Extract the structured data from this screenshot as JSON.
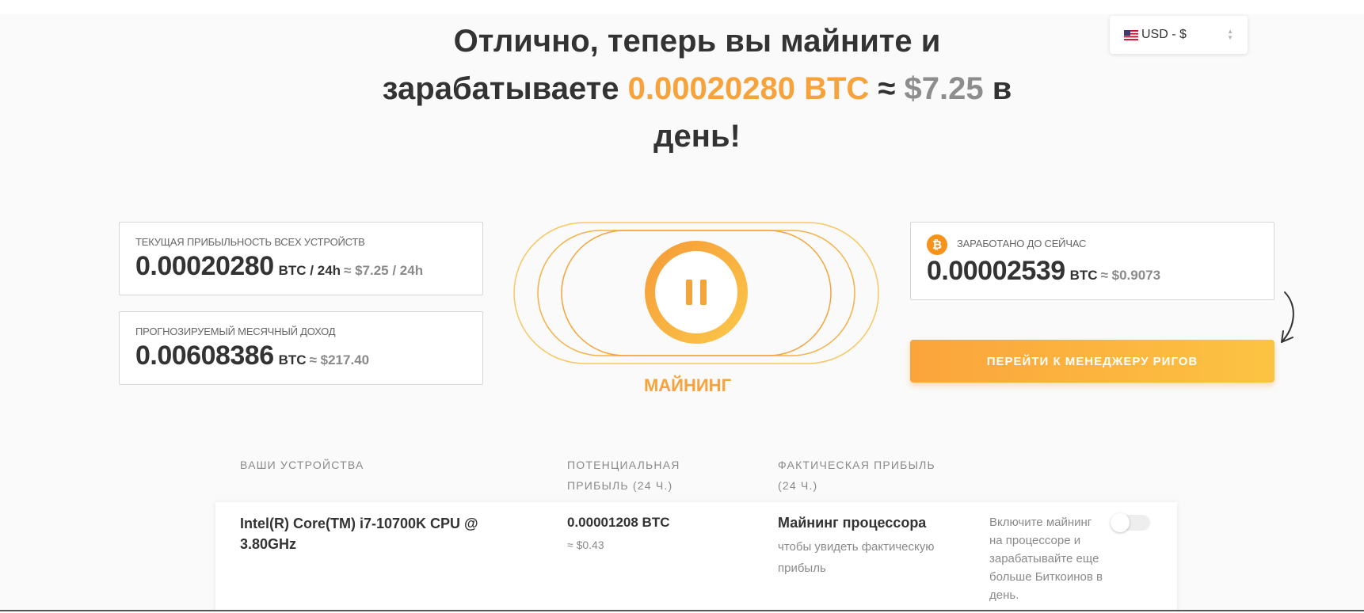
{
  "headline": {
    "line1": "Отлично, теперь вы майните и",
    "line2_prefix": "зарабатываете",
    "btc_amount": "0.00020280",
    "btc_unit": "BTC",
    "approx": "≈",
    "usd_amount": "$7.25",
    "suffix": "в",
    "line3": "день!"
  },
  "currency_select": {
    "value": "USD - $",
    "icon": "us-flag-icon"
  },
  "stats": {
    "current_profit": {
      "label": "ТЕКУЩАЯ ПРИБЫЛЬНОСТЬ ВСЕХ УСТРОЙСТВ",
      "value": "0.00020280",
      "unit": "BTC / 24h",
      "approx": "≈ $7.25 / 24h"
    },
    "monthly_forecast": {
      "label": "ПРОГНОЗИРУЕМЫЙ МЕСЯЧНЫЙ ДОХОД",
      "value": "0.00608386",
      "unit": "BTC",
      "approx": "≈ $217.40"
    },
    "earned": {
      "label": "ЗАРАБОТАНО ДО СЕЙЧАС",
      "value": "0.00002539",
      "unit": "BTC",
      "approx": "≈ $0.9073",
      "icon": "bitcoin-icon"
    }
  },
  "mining": {
    "status_label": "МАЙНИНГ",
    "button_icon": "pause-icon"
  },
  "rig_manager_button": {
    "label": "ПЕРЕЙТИ К МЕНЕДЖЕРУ РИГОВ"
  },
  "devices_table": {
    "headers": {
      "devices": "ВАШИ УСТРОЙСТВА",
      "potential_line1": "ПОТЕНЦИАЛЬНАЯ",
      "potential_line2": "ПРИБЫЛЬ (24 Ч.)",
      "actual_line1": "ФАКТИЧЕСКАЯ ПРИБЫЛЬ",
      "actual_line2": "(24 Ч.)"
    },
    "rows": [
      {
        "name_line1": "Intel(R) Core(TM) i7-10700K CPU @",
        "name_line2": "3.80GHz",
        "potential_btc": "0.00001208 BTC",
        "potential_usd": "≈ $0.43",
        "actual_title": "Майнинг процессора",
        "actual_note": "чтобы увидеть фактическую прибыль",
        "hint": "Включите майнинг на процессоре и зарабатывайте еще больше Биткоинов в день.",
        "toggle_on": false
      }
    ]
  },
  "colors": {
    "accent_orange": "#f7a23a",
    "accent_yellow": "#fcc342",
    "muted_gray": "#8a8a8a",
    "text_dark": "#333333"
  }
}
